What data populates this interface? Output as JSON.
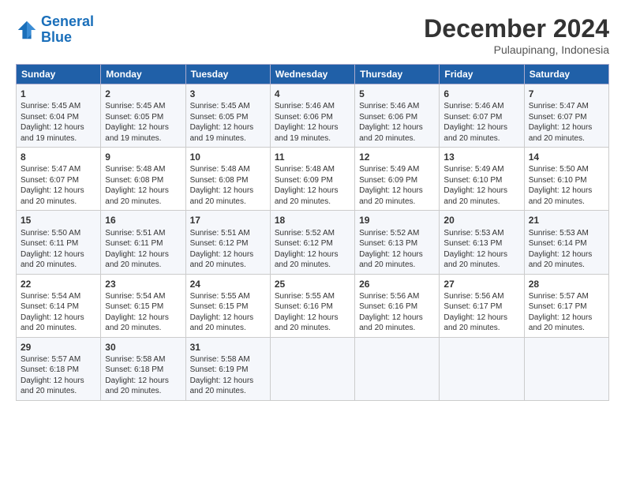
{
  "logo": {
    "line1": "General",
    "line2": "Blue"
  },
  "title": "December 2024",
  "subtitle": "Pulaupinang, Indonesia",
  "days_header": [
    "Sunday",
    "Monday",
    "Tuesday",
    "Wednesday",
    "Thursday",
    "Friday",
    "Saturday"
  ],
  "weeks": [
    [
      {
        "day": 1,
        "lines": [
          "Sunrise: 5:45 AM",
          "Sunset: 6:04 PM",
          "Daylight: 12 hours",
          "and 19 minutes."
        ]
      },
      {
        "day": 2,
        "lines": [
          "Sunrise: 5:45 AM",
          "Sunset: 6:05 PM",
          "Daylight: 12 hours",
          "and 19 minutes."
        ]
      },
      {
        "day": 3,
        "lines": [
          "Sunrise: 5:45 AM",
          "Sunset: 6:05 PM",
          "Daylight: 12 hours",
          "and 19 minutes."
        ]
      },
      {
        "day": 4,
        "lines": [
          "Sunrise: 5:46 AM",
          "Sunset: 6:06 PM",
          "Daylight: 12 hours",
          "and 19 minutes."
        ]
      },
      {
        "day": 5,
        "lines": [
          "Sunrise: 5:46 AM",
          "Sunset: 6:06 PM",
          "Daylight: 12 hours",
          "and 20 minutes."
        ]
      },
      {
        "day": 6,
        "lines": [
          "Sunrise: 5:46 AM",
          "Sunset: 6:07 PM",
          "Daylight: 12 hours",
          "and 20 minutes."
        ]
      },
      {
        "day": 7,
        "lines": [
          "Sunrise: 5:47 AM",
          "Sunset: 6:07 PM",
          "Daylight: 12 hours",
          "and 20 minutes."
        ]
      }
    ],
    [
      {
        "day": 8,
        "lines": [
          "Sunrise: 5:47 AM",
          "Sunset: 6:07 PM",
          "Daylight: 12 hours",
          "and 20 minutes."
        ]
      },
      {
        "day": 9,
        "lines": [
          "Sunrise: 5:48 AM",
          "Sunset: 6:08 PM",
          "Daylight: 12 hours",
          "and 20 minutes."
        ]
      },
      {
        "day": 10,
        "lines": [
          "Sunrise: 5:48 AM",
          "Sunset: 6:08 PM",
          "Daylight: 12 hours",
          "and 20 minutes."
        ]
      },
      {
        "day": 11,
        "lines": [
          "Sunrise: 5:48 AM",
          "Sunset: 6:09 PM",
          "Daylight: 12 hours",
          "and 20 minutes."
        ]
      },
      {
        "day": 12,
        "lines": [
          "Sunrise: 5:49 AM",
          "Sunset: 6:09 PM",
          "Daylight: 12 hours",
          "and 20 minutes."
        ]
      },
      {
        "day": 13,
        "lines": [
          "Sunrise: 5:49 AM",
          "Sunset: 6:10 PM",
          "Daylight: 12 hours",
          "and 20 minutes."
        ]
      },
      {
        "day": 14,
        "lines": [
          "Sunrise: 5:50 AM",
          "Sunset: 6:10 PM",
          "Daylight: 12 hours",
          "and 20 minutes."
        ]
      }
    ],
    [
      {
        "day": 15,
        "lines": [
          "Sunrise: 5:50 AM",
          "Sunset: 6:11 PM",
          "Daylight: 12 hours",
          "and 20 minutes."
        ]
      },
      {
        "day": 16,
        "lines": [
          "Sunrise: 5:51 AM",
          "Sunset: 6:11 PM",
          "Daylight: 12 hours",
          "and 20 minutes."
        ]
      },
      {
        "day": 17,
        "lines": [
          "Sunrise: 5:51 AM",
          "Sunset: 6:12 PM",
          "Daylight: 12 hours",
          "and 20 minutes."
        ]
      },
      {
        "day": 18,
        "lines": [
          "Sunrise: 5:52 AM",
          "Sunset: 6:12 PM",
          "Daylight: 12 hours",
          "and 20 minutes."
        ]
      },
      {
        "day": 19,
        "lines": [
          "Sunrise: 5:52 AM",
          "Sunset: 6:13 PM",
          "Daylight: 12 hours",
          "and 20 minutes."
        ]
      },
      {
        "day": 20,
        "lines": [
          "Sunrise: 5:53 AM",
          "Sunset: 6:13 PM",
          "Daylight: 12 hours",
          "and 20 minutes."
        ]
      },
      {
        "day": 21,
        "lines": [
          "Sunrise: 5:53 AM",
          "Sunset: 6:14 PM",
          "Daylight: 12 hours",
          "and 20 minutes."
        ]
      }
    ],
    [
      {
        "day": 22,
        "lines": [
          "Sunrise: 5:54 AM",
          "Sunset: 6:14 PM",
          "Daylight: 12 hours",
          "and 20 minutes."
        ]
      },
      {
        "day": 23,
        "lines": [
          "Sunrise: 5:54 AM",
          "Sunset: 6:15 PM",
          "Daylight: 12 hours",
          "and 20 minutes."
        ]
      },
      {
        "day": 24,
        "lines": [
          "Sunrise: 5:55 AM",
          "Sunset: 6:15 PM",
          "Daylight: 12 hours",
          "and 20 minutes."
        ]
      },
      {
        "day": 25,
        "lines": [
          "Sunrise: 5:55 AM",
          "Sunset: 6:16 PM",
          "Daylight: 12 hours",
          "and 20 minutes."
        ]
      },
      {
        "day": 26,
        "lines": [
          "Sunrise: 5:56 AM",
          "Sunset: 6:16 PM",
          "Daylight: 12 hours",
          "and 20 minutes."
        ]
      },
      {
        "day": 27,
        "lines": [
          "Sunrise: 5:56 AM",
          "Sunset: 6:17 PM",
          "Daylight: 12 hours",
          "and 20 minutes."
        ]
      },
      {
        "day": 28,
        "lines": [
          "Sunrise: 5:57 AM",
          "Sunset: 6:17 PM",
          "Daylight: 12 hours",
          "and 20 minutes."
        ]
      }
    ],
    [
      {
        "day": 29,
        "lines": [
          "Sunrise: 5:57 AM",
          "Sunset: 6:18 PM",
          "Daylight: 12 hours",
          "and 20 minutes."
        ]
      },
      {
        "day": 30,
        "lines": [
          "Sunrise: 5:58 AM",
          "Sunset: 6:18 PM",
          "Daylight: 12 hours",
          "and 20 minutes."
        ]
      },
      {
        "day": 31,
        "lines": [
          "Sunrise: 5:58 AM",
          "Sunset: 6:19 PM",
          "Daylight: 12 hours",
          "and 20 minutes."
        ]
      },
      null,
      null,
      null,
      null
    ]
  ]
}
